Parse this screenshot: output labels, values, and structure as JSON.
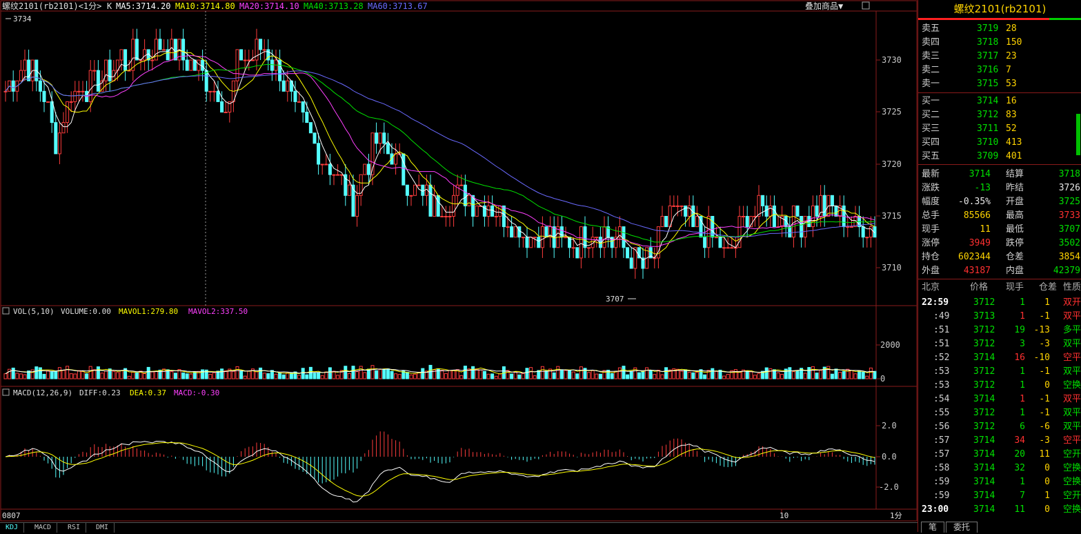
{
  "main_header": {
    "symbol": "螺纹2101(rb2101)<1分>",
    "k": "K",
    "ma5": "MA5:3714.20",
    "ma10": "MA10:3714.80",
    "ma20": "MA20:3714.10",
    "ma40": "MA40:3713.28",
    "ma60": "MA60:3713.67",
    "overlay_btn": "叠加商品▼",
    "high_marker": "3734",
    "low_marker": "3707"
  },
  "price_axis": [
    "3730",
    "3725",
    "3720",
    "3715",
    "3710"
  ],
  "vol_header": {
    "name": "VOL(5,10)",
    "volume": "VOLUME:0.00",
    "mavol1": "MAVOL1:279.80",
    "mavol2": "MAVOL2:337.50"
  },
  "vol_axis": [
    "2000",
    "0"
  ],
  "macd_header": {
    "name": "MACD(12,26,9)",
    "diff": "DIFF:0.23",
    "dea": "DEA:0.37",
    "macd": "MACD:-0.30"
  },
  "macd_axis": [
    "2.0",
    "0.0",
    "-2.0"
  ],
  "time_axis": {
    "start": "0807",
    "mark": "10",
    "period": "1分"
  },
  "bottom_tabs": [
    "KDJ",
    "MACD",
    "RSI",
    "DMI"
  ],
  "colors": {
    "up": "#ff3c3c",
    "down": "#54ffff",
    "ma5": "#ffffff",
    "ma10": "#ffff00",
    "ma20": "#ff40ff",
    "ma40": "#00e000",
    "ma60": "#6a6aff",
    "grid": "#8a1b1b"
  },
  "quote": {
    "title": "螺纹2101(rb2101)",
    "asks": [
      {
        "label": "卖五",
        "price": "3719",
        "vol": "28"
      },
      {
        "label": "卖四",
        "price": "3718",
        "vol": "150"
      },
      {
        "label": "卖三",
        "price": "3717",
        "vol": "23"
      },
      {
        "label": "卖二",
        "price": "3716",
        "vol": "7"
      },
      {
        "label": "卖一",
        "price": "3715",
        "vol": "53"
      }
    ],
    "bids": [
      {
        "label": "买一",
        "price": "3714",
        "vol": "16"
      },
      {
        "label": "买二",
        "price": "3712",
        "vol": "83"
      },
      {
        "label": "买三",
        "price": "3711",
        "vol": "52"
      },
      {
        "label": "买四",
        "price": "3710",
        "vol": "413"
      },
      {
        "label": "买五",
        "price": "3709",
        "vol": "401"
      }
    ],
    "stats": [
      {
        "l1": "最新",
        "v1": "3714",
        "c1": "green",
        "l2": "结算",
        "v2": "3718",
        "c2": "green"
      },
      {
        "l1": "涨跌",
        "v1": "-13",
        "c1": "green",
        "l2": "昨结",
        "v2": "3726",
        "c2": "white"
      },
      {
        "l1": "幅度",
        "v1": "-0.35%",
        "c1": "white",
        "l2": "开盘",
        "v2": "3725",
        "c2": "green"
      },
      {
        "l1": "总手",
        "v1": "85566",
        "c1": "yellow",
        "l2": "最高",
        "v2": "3733",
        "c2": "red"
      },
      {
        "l1": "现手",
        "v1": "11",
        "c1": "yellow",
        "l2": "最低",
        "v2": "3707",
        "c2": "green"
      },
      {
        "l1": "涨停",
        "v1": "3949",
        "c1": "red",
        "l2": "跌停",
        "v2": "3502",
        "c2": "green"
      },
      {
        "l1": "持仓",
        "v1": "602344",
        "c1": "yellow",
        "l2": "仓差",
        "v2": "3854",
        "c2": "yellow"
      },
      {
        "l1": "外盘",
        "v1": "43187",
        "c1": "red",
        "l2": "内盘",
        "v2": "42379",
        "c2": "green"
      }
    ],
    "tick_header": [
      "北京",
      "价格",
      "现手",
      "仓差",
      "性质"
    ],
    "ticks": [
      {
        "time": "22:59",
        "price": "3712",
        "pc": "green",
        "qty": "1",
        "qc": "green",
        "oi": "1",
        "oc": "yellow",
        "nature": "双开",
        "nc": "red",
        "bold": true
      },
      {
        "time": ":49",
        "price": "3713",
        "pc": "green",
        "qty": "1",
        "qc": "red",
        "oi": "-1",
        "oc": "yellow",
        "nature": "双平",
        "nc": "red",
        "bold": false
      },
      {
        "time": ":51",
        "price": "3712",
        "pc": "green",
        "qty": "19",
        "qc": "green",
        "oi": "-13",
        "oc": "yellow",
        "nature": "多平",
        "nc": "green",
        "bold": false
      },
      {
        "time": ":51",
        "price": "3712",
        "pc": "green",
        "qty": "3",
        "qc": "green",
        "oi": "-3",
        "oc": "yellow",
        "nature": "双平",
        "nc": "green",
        "bold": false
      },
      {
        "time": ":52",
        "price": "3714",
        "pc": "green",
        "qty": "16",
        "qc": "red",
        "oi": "-10",
        "oc": "yellow",
        "nature": "空平",
        "nc": "red",
        "bold": false
      },
      {
        "time": ":53",
        "price": "3712",
        "pc": "green",
        "qty": "1",
        "qc": "green",
        "oi": "-1",
        "oc": "yellow",
        "nature": "双平",
        "nc": "green",
        "bold": false
      },
      {
        "time": ":53",
        "price": "3712",
        "pc": "green",
        "qty": "1",
        "qc": "green",
        "oi": "0",
        "oc": "yellow",
        "nature": "空换",
        "nc": "green",
        "bold": false
      },
      {
        "time": ":54",
        "price": "3714",
        "pc": "green",
        "qty": "1",
        "qc": "red",
        "oi": "-1",
        "oc": "yellow",
        "nature": "双平",
        "nc": "red",
        "bold": false
      },
      {
        "time": ":55",
        "price": "3712",
        "pc": "green",
        "qty": "1",
        "qc": "green",
        "oi": "-1",
        "oc": "yellow",
        "nature": "双平",
        "nc": "green",
        "bold": false
      },
      {
        "time": ":56",
        "price": "3712",
        "pc": "green",
        "qty": "6",
        "qc": "green",
        "oi": "-6",
        "oc": "yellow",
        "nature": "双平",
        "nc": "green",
        "bold": false
      },
      {
        "time": ":57",
        "price": "3714",
        "pc": "green",
        "qty": "34",
        "qc": "red",
        "oi": "-3",
        "oc": "yellow",
        "nature": "空平",
        "nc": "red",
        "bold": false
      },
      {
        "time": ":57",
        "price": "3714",
        "pc": "green",
        "qty": "20",
        "qc": "green",
        "oi": "11",
        "oc": "yellow",
        "nature": "空开",
        "nc": "green",
        "bold": false
      },
      {
        "time": ":58",
        "price": "3714",
        "pc": "green",
        "qty": "32",
        "qc": "green",
        "oi": "0",
        "oc": "yellow",
        "nature": "空换",
        "nc": "green",
        "bold": false
      },
      {
        "time": ":59",
        "price": "3714",
        "pc": "green",
        "qty": "1",
        "qc": "green",
        "oi": "0",
        "oc": "yellow",
        "nature": "空换",
        "nc": "green",
        "bold": false
      },
      {
        "time": ":59",
        "price": "3714",
        "pc": "green",
        "qty": "7",
        "qc": "green",
        "oi": "1",
        "oc": "yellow",
        "nature": "空开",
        "nc": "green",
        "bold": false
      },
      {
        "time": "23:00",
        "price": "3714",
        "pc": "green",
        "qty": "11",
        "qc": "green",
        "oi": "0",
        "oc": "yellow",
        "nature": "空换",
        "nc": "green",
        "bold": true
      }
    ],
    "tabs": [
      "笔",
      "委托"
    ]
  },
  "chart_data": [
    {
      "type": "candlestick",
      "title": "螺纹2101(rb2101)<1分>",
      "ylim": [
        3706,
        3737
      ],
      "series": [
        {
          "name": "MA5",
          "values": [
            3714.2
          ]
        },
        {
          "name": "MA10",
          "values": [
            3714.8
          ]
        },
        {
          "name": "MA20",
          "values": [
            3714.1
          ]
        },
        {
          "name": "MA40",
          "values": [
            3713.28
          ]
        },
        {
          "name": "MA60",
          "values": [
            3713.67
          ]
        }
      ],
      "annotations": [
        {
          "label": "3734",
          "value": 3734
        },
        {
          "label": "3707",
          "value": 3707
        }
      ]
    },
    {
      "type": "bar",
      "title": "VOL(5,10)",
      "series": [
        {
          "name": "MAVOL1",
          "values": [
            279.8
          ]
        },
        {
          "name": "MAVOL2",
          "values": [
            337.5
          ]
        }
      ],
      "ylim": [
        0,
        2500
      ]
    },
    {
      "type": "bar",
      "title": "MACD(12,26,9)",
      "series": [
        {
          "name": "DIFF",
          "values": [
            0.23
          ]
        },
        {
          "name": "DEA",
          "values": [
            0.37
          ]
        },
        {
          "name": "MACD",
          "values": [
            -0.3
          ]
        }
      ],
      "ylim": [
        -3,
        4
      ]
    }
  ]
}
